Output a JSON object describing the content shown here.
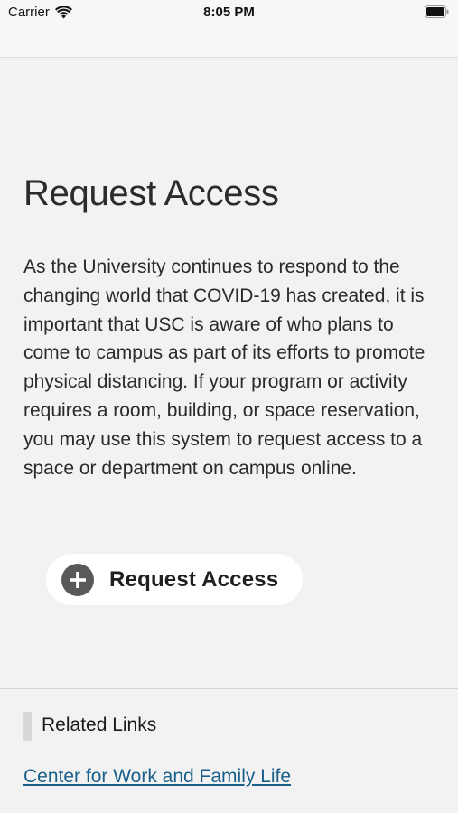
{
  "status_bar": {
    "carrier": "Carrier",
    "time": "8:05 PM",
    "icons": [
      "wifi-icon",
      "battery-icon"
    ]
  },
  "main": {
    "title": "Request Access",
    "body": "As the University continues to respond to the changing world that COVID-19 has created, it is important that USC is aware of who plans to come to campus as part of its efforts to promote physical distancing. If your program or activity requires a room, building, or space reservation, you may use this system to request access to a space or department on campus online.",
    "button": {
      "icon": "plus-circle-icon",
      "label": "Request Access"
    }
  },
  "related": {
    "heading": "Related Links",
    "links": [
      {
        "label": "Center for Work and Family Life"
      }
    ]
  },
  "colors": {
    "background": "#f2f2f2",
    "link": "#1a5f8a",
    "button_bg": "#ffffff",
    "icon_circle": "#595959"
  }
}
